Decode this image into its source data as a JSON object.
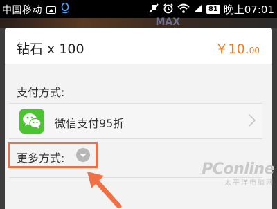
{
  "status_bar": {
    "carrier": "中国移动",
    "battery": "81",
    "time": "晚上07:01",
    "icons": [
      "image-icon",
      "qq-icon",
      "mute-icon",
      "alarm-icon",
      "wifi-icon",
      "signal-icon",
      "battery-icon"
    ]
  },
  "background": {
    "deco_text": "MAX"
  },
  "dialog": {
    "product": "钻石 x 100",
    "price_main": "￥10.",
    "price_cents": "00",
    "payment_method_label": "支付方式:",
    "wechat_option": "微信支付95折",
    "more_methods_label": "更多方式:"
  },
  "watermark": {
    "brand": "PConline",
    "sub": "太平洋电脑网"
  },
  "colors": {
    "accent_orange": "#f07d1e",
    "wechat_green": "#4bc332",
    "highlight_border": "#f07046"
  }
}
